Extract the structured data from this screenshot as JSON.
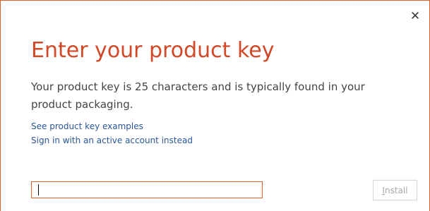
{
  "dialog": {
    "close_glyph": "✕",
    "title": "Enter your product key",
    "description": "Your product key is 25 characters and is typically found in your product packaging.",
    "links": {
      "examples": "See product key examples",
      "signin": "Sign in with an active account instead"
    },
    "product_key_input": {
      "value": "",
      "placeholder": ""
    },
    "install_button": {
      "accelerator": "I",
      "rest": "nstall",
      "disabled": true
    }
  },
  "colors": {
    "accent": "#d24726",
    "border_accent": "#d9602a",
    "link": "#2b579a",
    "body_text": "#444444",
    "disabled_text": "#a6a6a6"
  },
  "icons": {
    "close": "close-icon"
  }
}
